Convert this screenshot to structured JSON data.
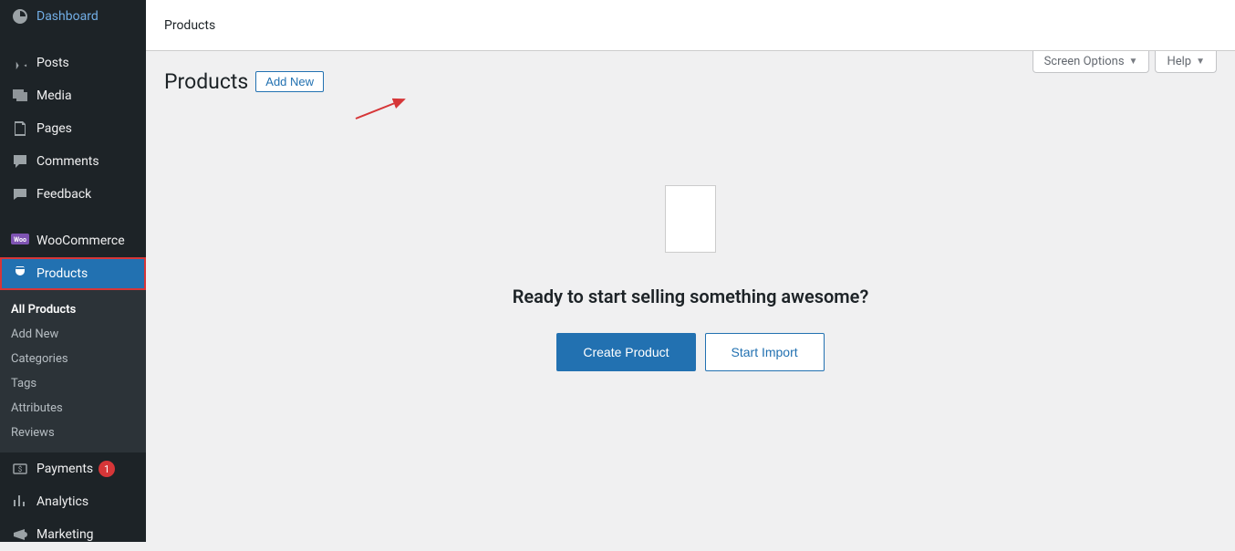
{
  "sidebar": {
    "items": [
      {
        "label": "Dashboard",
        "icon": "dashboard"
      },
      {
        "label": "Posts",
        "icon": "pin"
      },
      {
        "label": "Media",
        "icon": "media"
      },
      {
        "label": "Pages",
        "icon": "pages"
      },
      {
        "label": "Comments",
        "icon": "comments"
      },
      {
        "label": "Feedback",
        "icon": "feedback"
      },
      {
        "label": "WooCommerce",
        "icon": "woo"
      },
      {
        "label": "Products",
        "icon": "products"
      },
      {
        "label": "Payments",
        "icon": "payments",
        "badge": "1"
      },
      {
        "label": "Analytics",
        "icon": "analytics"
      },
      {
        "label": "Marketing",
        "icon": "marketing"
      }
    ],
    "submenu": [
      {
        "label": "All Products"
      },
      {
        "label": "Add New"
      },
      {
        "label": "Categories"
      },
      {
        "label": "Tags"
      },
      {
        "label": "Attributes"
      },
      {
        "label": "Reviews"
      }
    ]
  },
  "topbar": {
    "title": "Products"
  },
  "meta": {
    "screen_options": "Screen Options",
    "help": "Help"
  },
  "page": {
    "title": "Products",
    "add_new": "Add New",
    "empty_title": "Ready to start selling something awesome?",
    "create_product": "Create Product",
    "start_import": "Start Import"
  }
}
